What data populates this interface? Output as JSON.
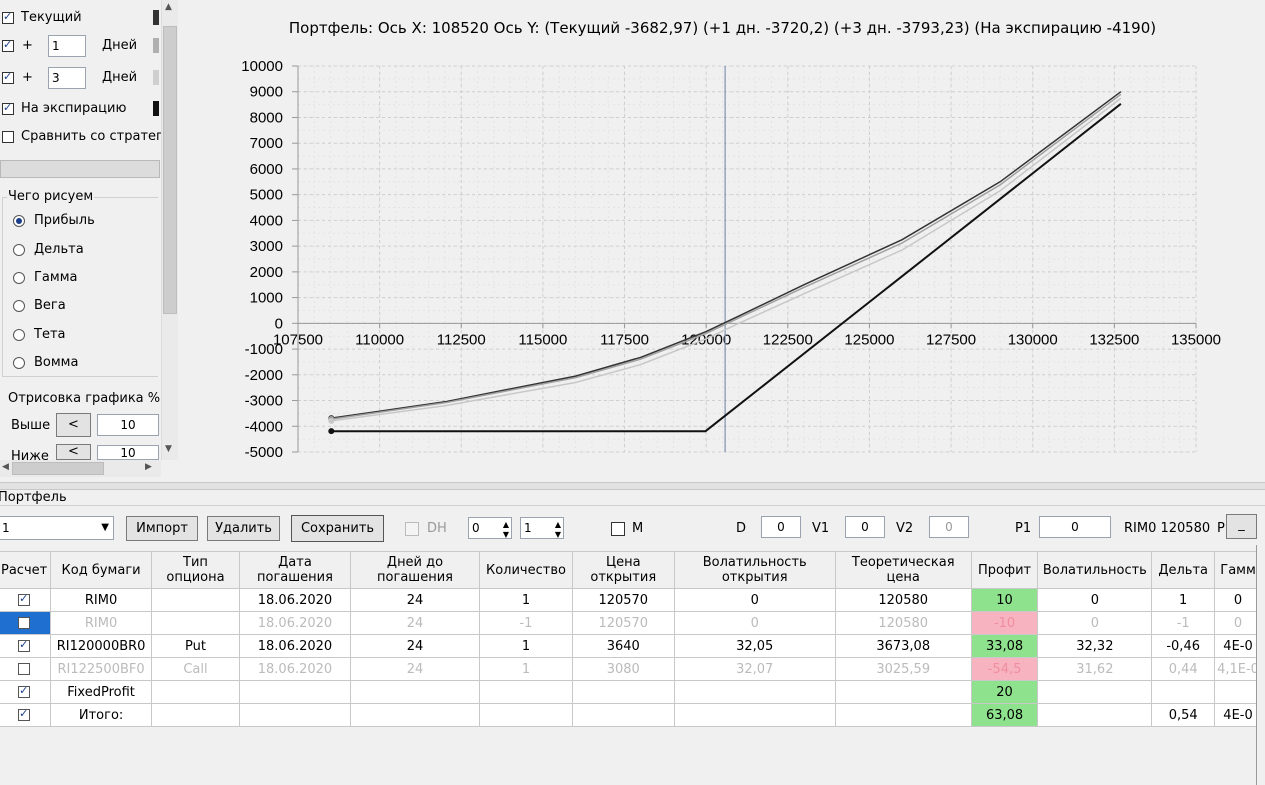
{
  "left": {
    "cb_current": "Текущий",
    "cb_plus1": "+",
    "plus1_value": "1",
    "days1": "Дней",
    "cb_plus3": "+",
    "plus3_value": "3",
    "days3": "Дней",
    "cb_expiration": "На экспирацию",
    "cb_compare": "Сравнить со стратеги",
    "draw_group_title": "Чего рисуем",
    "radio_items": [
      "Прибыль",
      "Дельта",
      "Гамма",
      "Вега",
      "Тета",
      "Вомма"
    ],
    "render_title": "Отрисовка графика %",
    "above_label": "Выше",
    "above_btn": "<",
    "above_value": "10",
    "below_label": "Ниже",
    "below_btn": "<",
    "below_value": "10",
    "colors": {
      "current": "#333333",
      "plus1": "#a0a0a0",
      "plus3": "#c8c8c8",
      "expiration": "#000000"
    }
  },
  "chart_title": "Портфель: Ось X: 108520 Ось Y:  (Текущий -3682,97)  (+1 дн. -3720,2)  (+3 дн. -3793,23)  (На экспирацию -4190)",
  "chart_data": {
    "type": "line",
    "title": "Портфель: Ось X: 108520 Ось Y:  (Текущий -3682,97)  (+1 дн. -3720,2)  (+3 дн. -3793,23)  (На экспирацию -4190)",
    "xlim": [
      107500,
      135000
    ],
    "ylim": [
      -5000,
      10000
    ],
    "x_ticks": [
      "107500",
      "110000",
      "112500",
      "115000",
      "117500",
      "120000",
      "122500",
      "125000",
      "127500",
      "130000",
      "132500",
      "135000"
    ],
    "y_ticks": [
      "10000",
      "9000",
      "8000",
      "7000",
      "6000",
      "5000",
      "4000",
      "3000",
      "2000",
      "1000",
      "0",
      "-1000",
      "-2000",
      "-3000",
      "-4000",
      "-5000"
    ],
    "current_x": 120580,
    "grid": true,
    "series": [
      {
        "color": "#333333",
        "x": [
          108520,
          112000,
          116000,
          118000,
          120000,
          121000,
          123000,
          126000,
          129000,
          132700
        ],
        "y": [
          -3683,
          -3050,
          -2050,
          -1320,
          -320,
          280,
          1500,
          3250,
          5500,
          9000
        ]
      },
      {
        "color": "#a0a0a0",
        "x": [
          108520,
          112000,
          116000,
          118000,
          120000,
          121000,
          123000,
          126000,
          129000,
          132700
        ],
        "y": [
          -3720,
          -3090,
          -2110,
          -1390,
          -390,
          210,
          1400,
          3120,
          5380,
          8900
        ]
      },
      {
        "color": "#c8c8c8",
        "x": [
          108520,
          112000,
          116000,
          118000,
          120000,
          121000,
          123000,
          126000,
          129000,
          132700
        ],
        "y": [
          -3793,
          -3200,
          -2300,
          -1600,
          -600,
          0,
          1150,
          2850,
          5150,
          8750
        ]
      },
      {
        "color": "#111111",
        "x": [
          108520,
          119980,
          132700
        ],
        "y": [
          -4190,
          -4190,
          8530
        ]
      }
    ]
  },
  "portfolio": {
    "title": "Портфель",
    "combo_value": "1",
    "btn_import": "Импорт",
    "btn_delete": "Удалить",
    "btn_save": "Сохранить",
    "dh_label": "DH",
    "spin1": "0",
    "spin2": "1",
    "m_label": "M",
    "d_label": "D",
    "d_value": "0",
    "v1_label": "V1",
    "v1_value": "0",
    "v2_label": "V2",
    "v2_value": "0",
    "p1_label": "P1",
    "p1_value": "0",
    "price_text": "RIM0 120580",
    "p_label": "P",
    "min_btn": "_"
  },
  "table": {
    "headers": [
      "Расчет",
      "Код бумаги",
      "Тип опциона",
      "Дата погашения",
      "Дней до погашения",
      "Количество",
      "Цена открытия",
      "Волатильность открытия",
      "Теоретическая цена",
      "Профит",
      "Волатильность",
      "Дельта",
      "Гамм"
    ],
    "rows": [
      {
        "checked": true,
        "disabled": false,
        "selected": false,
        "profit_color": "green",
        "cells": [
          "RIM0",
          "",
          "18.06.2020",
          "24",
          "1",
          "120570",
          "0",
          "120580",
          "10",
          "0",
          "1",
          "0"
        ]
      },
      {
        "checked": false,
        "disabled": true,
        "selected": true,
        "profit_color": "pink",
        "cells": [
          "RIM0",
          "",
          "18.06.2020",
          "24",
          "-1",
          "120570",
          "0",
          "120580",
          "-10",
          "0",
          "-1",
          "0"
        ]
      },
      {
        "checked": true,
        "disabled": false,
        "selected": false,
        "profit_color": "green",
        "cells": [
          "RI120000BR0",
          "Put",
          "18.06.2020",
          "24",
          "1",
          "3640",
          "32,05",
          "3673,08",
          "33,08",
          "32,32",
          "-0,46",
          "4E-0"
        ]
      },
      {
        "checked": false,
        "disabled": true,
        "selected": false,
        "profit_color": "pink",
        "cells": [
          "RI122500BF0",
          "Call",
          "18.06.2020",
          "24",
          "1",
          "3080",
          "32,07",
          "3025,59",
          "-54,5",
          "31,62",
          "0,44",
          "4,1E-0"
        ]
      },
      {
        "checked": true,
        "disabled": false,
        "selected": false,
        "profit_color": "green",
        "cells": [
          "FixedProfit",
          "",
          "",
          "",
          "",
          "",
          "",
          "",
          "20",
          "",
          "",
          ""
        ]
      },
      {
        "checked": true,
        "disabled": false,
        "selected": false,
        "profit_color": "green",
        "cells": [
          "Итого:",
          "",
          "",
          "",
          "",
          "",
          "",
          "",
          "63,08",
          "",
          "0,54",
          "4E-0"
        ]
      }
    ]
  }
}
